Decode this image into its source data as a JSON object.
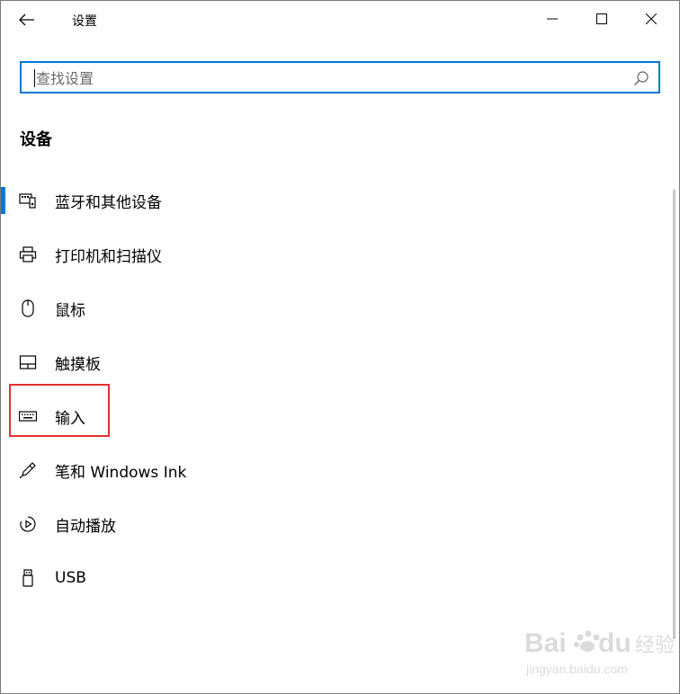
{
  "window": {
    "title": "设置",
    "controls": [
      "minimize-icon",
      "maximize-icon",
      "close-icon"
    ]
  },
  "search": {
    "placeholder": "查找设置",
    "value": "",
    "icon": "search-icon",
    "accent": "#0078d7"
  },
  "section": {
    "title": "设备"
  },
  "nav": {
    "items": [
      {
        "label": "蓝牙和其他设备",
        "icon": "bluetooth-devices-icon",
        "selected": true
      },
      {
        "label": "打印机和扫描仪",
        "icon": "printer-icon",
        "selected": false
      },
      {
        "label": "鼠标",
        "icon": "mouse-icon",
        "selected": false
      },
      {
        "label": "触摸板",
        "icon": "touchpad-icon",
        "selected": false
      },
      {
        "label": "输入",
        "icon": "keyboard-icon",
        "selected": false,
        "highlighted": true
      },
      {
        "label": "笔和 Windows Ink",
        "icon": "pen-icon",
        "selected": false
      },
      {
        "label": "自动播放",
        "icon": "autoplay-icon",
        "selected": false
      },
      {
        "label": "USB",
        "icon": "usb-icon",
        "selected": false
      }
    ]
  },
  "colors": {
    "accent": "#0078d7",
    "highlight_box": "#e0322e"
  },
  "watermark": {
    "brand": "Baidu",
    "suffix": "经验",
    "url": "jingyan.baidu.com"
  }
}
